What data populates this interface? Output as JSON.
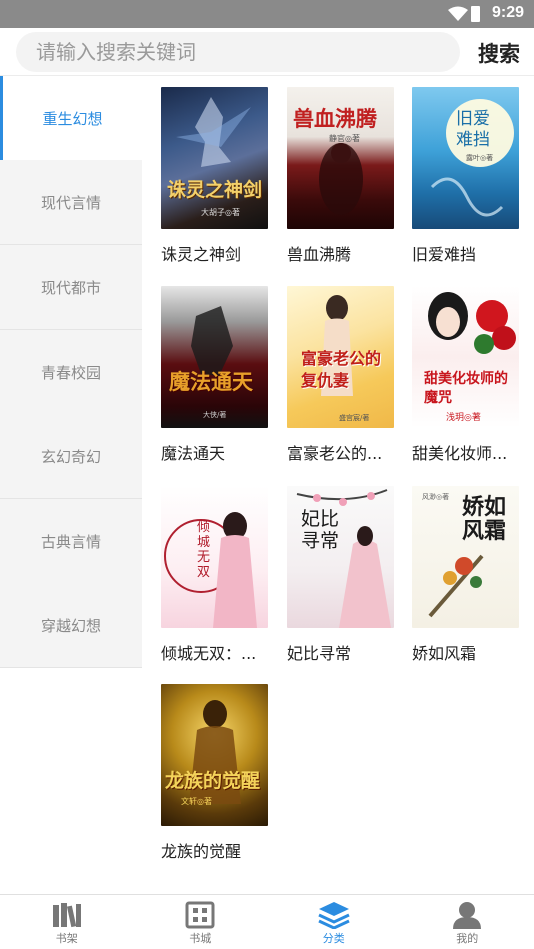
{
  "status": {
    "time": "9:29"
  },
  "search": {
    "placeholder": "请输入搜索关键词",
    "button": "搜索"
  },
  "categories": [
    {
      "label": "重生幻想",
      "active": true
    },
    {
      "label": "现代言情",
      "active": false
    },
    {
      "label": "现代都市",
      "active": false
    },
    {
      "label": "青春校园",
      "active": false
    },
    {
      "label": "玄幻奇幻",
      "active": false
    },
    {
      "label": "古典言情",
      "active": false
    },
    {
      "label": "穿越幻想",
      "active": false
    }
  ],
  "books": [
    {
      "title": "诛灵之神剑",
      "cover_text": "诛灵之神剑",
      "cover_author": "大胡子◎著"
    },
    {
      "title": "兽血沸腾",
      "cover_text": "兽血沸腾",
      "cover_author": "静官◎著"
    },
    {
      "title": "旧爱难挡",
      "cover_text": "旧爱难挡",
      "cover_author": "露叶◎著"
    },
    {
      "title": "魔法通天",
      "cover_text": "魔法通天",
      "cover_author": "大侠/著"
    },
    {
      "title": "富豪老公的...",
      "cover_text": "富豪老公的复仇妻",
      "cover_author": "盛宫宸/著"
    },
    {
      "title": "甜美化妆师...",
      "cover_text": "甜美化妆师的魔咒",
      "cover_author": "浅玥◎著"
    },
    {
      "title": "倾城无双：...",
      "cover_text": "倾城无双",
      "cover_author": ""
    },
    {
      "title": "妃比寻常",
      "cover_text": "妃比寻常",
      "cover_author": ""
    },
    {
      "title": "娇如风霜",
      "cover_text": "娇如风霜",
      "cover_author": "风渺◎著"
    },
    {
      "title": "龙族的觉醒",
      "cover_text": "龙族的觉醒",
      "cover_author": "文轩◎著"
    }
  ],
  "tabs": [
    {
      "label": "书架",
      "icon": "bookshelf-icon",
      "active": false
    },
    {
      "label": "书城",
      "icon": "bookstore-icon",
      "active": false
    },
    {
      "label": "分类",
      "icon": "layers-icon",
      "active": true
    },
    {
      "label": "我的",
      "icon": "profile-icon",
      "active": false
    }
  ],
  "colors": {
    "accent": "#2b8ce0",
    "statusbar": "#8a8a8a",
    "sidebar_bg": "#f4f4f4"
  }
}
